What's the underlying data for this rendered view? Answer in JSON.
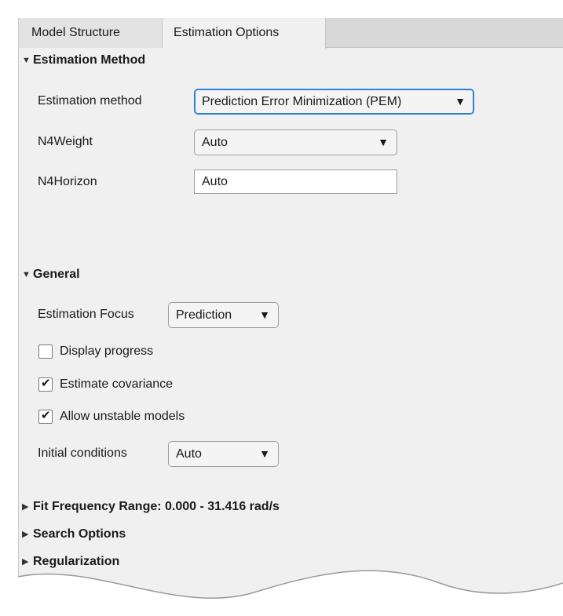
{
  "tabs": [
    {
      "label": "Model Structure"
    },
    {
      "label": "Estimation Options"
    }
  ],
  "estimation_method_section": {
    "title": "Estimation Method",
    "method_label": "Estimation method",
    "method_value": "Prediction Error Minimization (PEM)",
    "n4weight_label": "N4Weight",
    "n4weight_value": "Auto",
    "n4horizon_label": "N4Horizon",
    "n4horizon_value": "Auto"
  },
  "general_section": {
    "title": "General",
    "focus_label": "Estimation Focus",
    "focus_value": "Prediction",
    "display_progress_label": "Display progress",
    "display_progress_checked": false,
    "estimate_covariance_label": "Estimate covariance",
    "estimate_covariance_checked": true,
    "allow_unstable_label": "Allow unstable models",
    "allow_unstable_checked": true,
    "initial_conditions_label": "Initial conditions",
    "initial_conditions_value": "Auto"
  },
  "collapsed_sections": [
    {
      "title": "Fit Frequency Range: 0.000 - 31.416 rad/s"
    },
    {
      "title": "Search Options"
    },
    {
      "title": "Regularization"
    }
  ],
  "icons": {
    "expanded": "triangle-down-icon",
    "collapsed": "triangle-right-icon",
    "dropdown": "dropdown-arrow-icon",
    "checkmark": "checkmark-icon"
  },
  "colors": {
    "panel_bg": "#f0f0f0",
    "tab_bar_bg": "#d8d8d8",
    "focus_border": "#2f7fd6"
  }
}
